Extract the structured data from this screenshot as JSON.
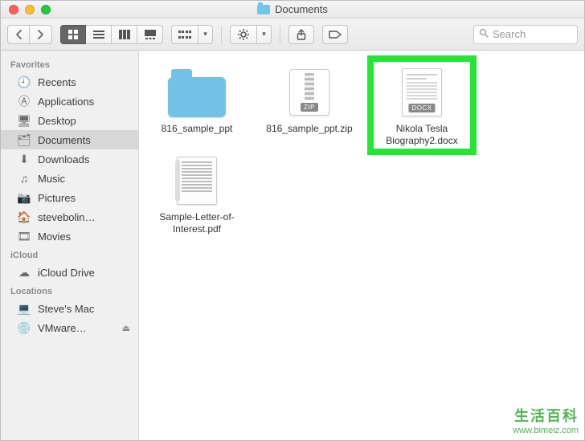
{
  "window": {
    "title": "Documents"
  },
  "toolbar": {
    "search_placeholder": "Search"
  },
  "sidebar": {
    "sections": [
      {
        "label": "Favorites",
        "items": [
          {
            "name": "Recents",
            "glyph": "🕘",
            "selected": false
          },
          {
            "name": "Applications",
            "glyph": "Ⓐ",
            "selected": false
          },
          {
            "name": "Desktop",
            "glyph": "🖥",
            "selected": false
          },
          {
            "name": "Documents",
            "glyph": "🗂",
            "selected": true
          },
          {
            "name": "Downloads",
            "glyph": "⬇︎",
            "selected": false
          },
          {
            "name": "Music",
            "glyph": "♫",
            "selected": false
          },
          {
            "name": "Pictures",
            "glyph": "📷",
            "selected": false
          },
          {
            "name": "stevebolin…",
            "glyph": "🏠",
            "selected": false
          },
          {
            "name": "Movies",
            "glyph": "🎞",
            "selected": false
          }
        ]
      },
      {
        "label": "iCloud",
        "items": [
          {
            "name": "iCloud Drive",
            "glyph": "☁︎",
            "selected": false
          }
        ]
      },
      {
        "label": "Locations",
        "items": [
          {
            "name": "Steve's Mac",
            "glyph": "💻",
            "selected": false
          },
          {
            "name": "VMware…",
            "glyph": "💿",
            "selected": false,
            "eject": true
          }
        ]
      }
    ]
  },
  "files": [
    {
      "name": "816_sample_ppt",
      "kind": "folder",
      "highlighted": false,
      "badge": ""
    },
    {
      "name": "816_sample_ppt.zip",
      "kind": "zip",
      "highlighted": false,
      "badge": "ZIP"
    },
    {
      "name": "Nikola Tesla Biography2.docx",
      "kind": "docx",
      "highlighted": true,
      "badge": "DOCX"
    },
    {
      "name": "Sample-Letter-of-Interest.pdf",
      "kind": "pdf",
      "highlighted": false,
      "badge": ""
    }
  ],
  "watermark": {
    "line1": "生活百科",
    "line2": "www.bimeiz.com"
  }
}
